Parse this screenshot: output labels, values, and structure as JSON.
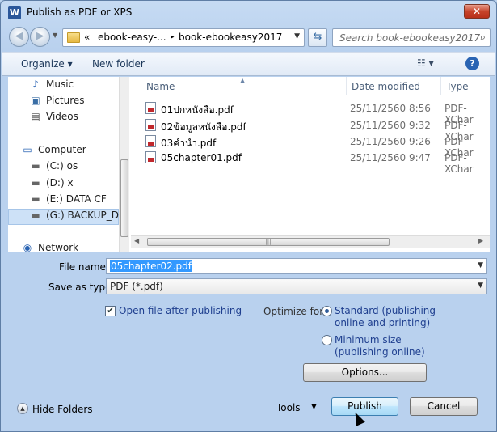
{
  "window": {
    "title": "Publish as PDF or XPS",
    "app_icon": "W",
    "close_glyph": "✕"
  },
  "nav": {
    "back_glyph": "◀",
    "forward_glyph": "▶",
    "breadcrumbs": [
      "«",
      "ebook-easy-...",
      "▸",
      "book-ebookeasy2017"
    ],
    "search_placeholder": "Search book-ebookeasy2017"
  },
  "toolbar": {
    "organize": "Organize ▾",
    "new_folder": "New folder",
    "view": "☷ ▾",
    "help": "?"
  },
  "sidebar": {
    "items": [
      {
        "label": "Music",
        "icon": "♪"
      },
      {
        "label": "Pictures",
        "icon": "▣"
      },
      {
        "label": "Videos",
        "icon": "▤"
      },
      {
        "label": "Computer",
        "icon": "▭"
      },
      {
        "label": "(C:) os",
        "icon": "▬"
      },
      {
        "label": "(D:) x",
        "icon": "▬"
      },
      {
        "label": "(E:) DATA CF",
        "icon": "▬"
      },
      {
        "label": "(G:) BACKUP_DRV",
        "icon": "▬"
      },
      {
        "label": "Network",
        "icon": "◉"
      }
    ]
  },
  "files": {
    "columns": [
      "Name",
      "Date modified",
      "Type"
    ],
    "rows": [
      {
        "name": "01ปกหนังสือ.pdf",
        "date": "25/11/2560 8:56",
        "type": "PDF-XChar"
      },
      {
        "name": "02ข้อมูลหนังสือ.pdf",
        "date": "25/11/2560 9:32",
        "type": "PDF-XChar"
      },
      {
        "name": "03คำนำ.pdf",
        "date": "25/11/2560 9:26",
        "type": "PDF-XChar"
      },
      {
        "name": "05chapter01.pdf",
        "date": "25/11/2560 9:47",
        "type": "PDF-XChar"
      }
    ]
  },
  "form": {
    "file_name_label": "File name:",
    "file_name_value": "05chapter02.pdf",
    "save_type_label": "Save as type:",
    "save_type_value": "PDF (*.pdf)",
    "open_after_label": "Open file after publishing",
    "open_after_checked": true,
    "optimize_label": "Optimize for:",
    "standard_line1": "Standard (publishing",
    "standard_line2": "online and printing)",
    "minimum_line1": "Minimum size",
    "minimum_line2": "(publishing online)",
    "options_button": "Options..."
  },
  "footer": {
    "hide_folders": "Hide Folders",
    "tools": "Tools",
    "publish": "Publish",
    "cancel": "Cancel"
  }
}
